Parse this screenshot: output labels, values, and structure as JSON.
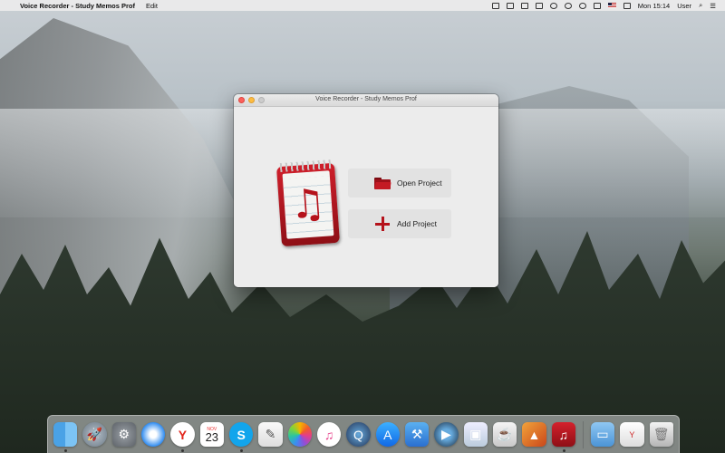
{
  "menubar": {
    "app_name": "Voice Recorder - Study Memos Prof",
    "menus": [
      "Edit"
    ],
    "clock": "Mon 15:14",
    "user": "User"
  },
  "window": {
    "title": "Voice Recorder - Study Memos Prof",
    "open_project_label": "Open Project",
    "add_project_label": "Add Project"
  },
  "dock": {
    "calendar_month": "NOV",
    "calendar_day": "23"
  },
  "colors": {
    "accent_red": "#b5121b",
    "window_bg": "#ececec",
    "button_bg": "#e2e2e2"
  }
}
